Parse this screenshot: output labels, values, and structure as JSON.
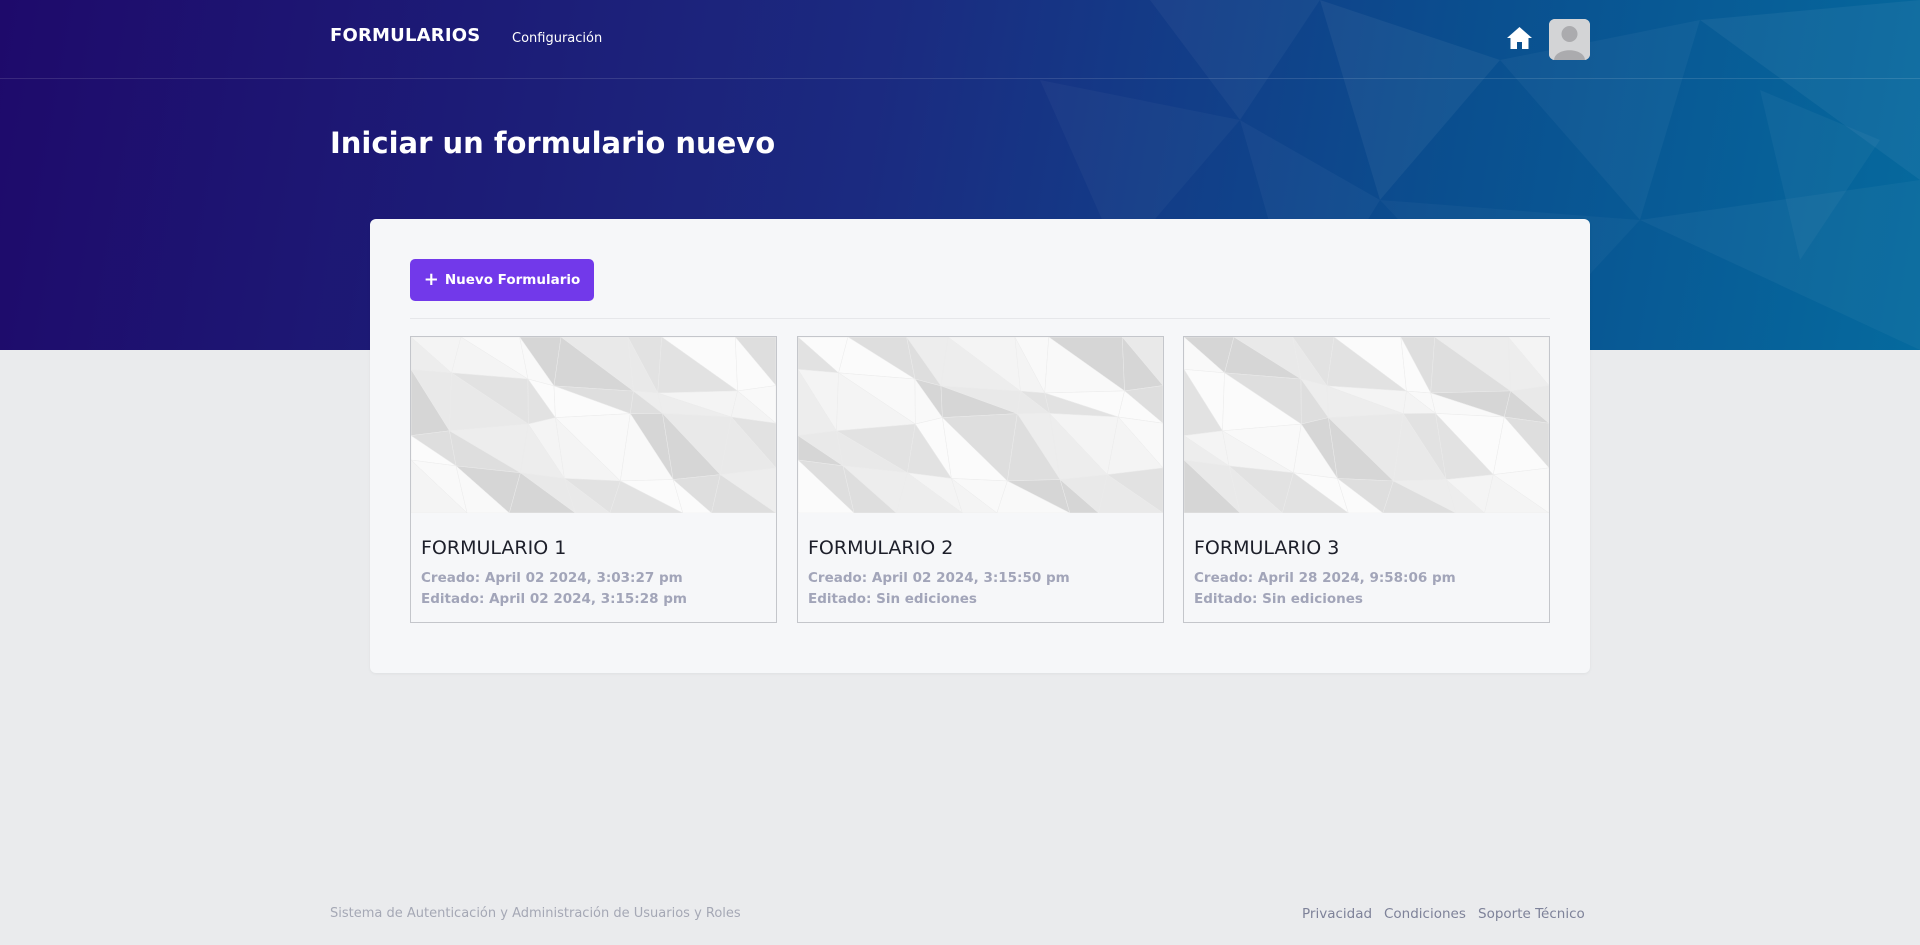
{
  "header": {
    "brand": "FORMULARIOS",
    "nav_config": "Configuración",
    "home_icon": "home-icon",
    "avatar_icon": "user-avatar-icon"
  },
  "page": {
    "title": "Iniciar un formulario nuevo"
  },
  "toolbar": {
    "new_button_icon": "+",
    "new_button_label": "Nuevo Formulario",
    "accent_color": "#7239ea"
  },
  "forms": [
    {
      "title": "FORMULARIO 1",
      "created": "Creado: April 02 2024, 3:03:27 pm",
      "edited": "Editado: April 02 2024, 3:15:28 pm"
    },
    {
      "title": "FORMULARIO 2",
      "created": "Creado: April 02 2024, 3:15:50 pm",
      "edited": "Editado: Sin ediciones"
    },
    {
      "title": "FORMULARIO 3",
      "created": "Creado: April 28 2024, 9:58:06 pm",
      "edited": "Editado: Sin ediciones"
    }
  ],
  "footer": {
    "text": "Sistema de Autenticación y Administración de Usuarios y Roles",
    "links": [
      "Privacidad",
      "Condiciones",
      "Soporte Técnico"
    ]
  }
}
